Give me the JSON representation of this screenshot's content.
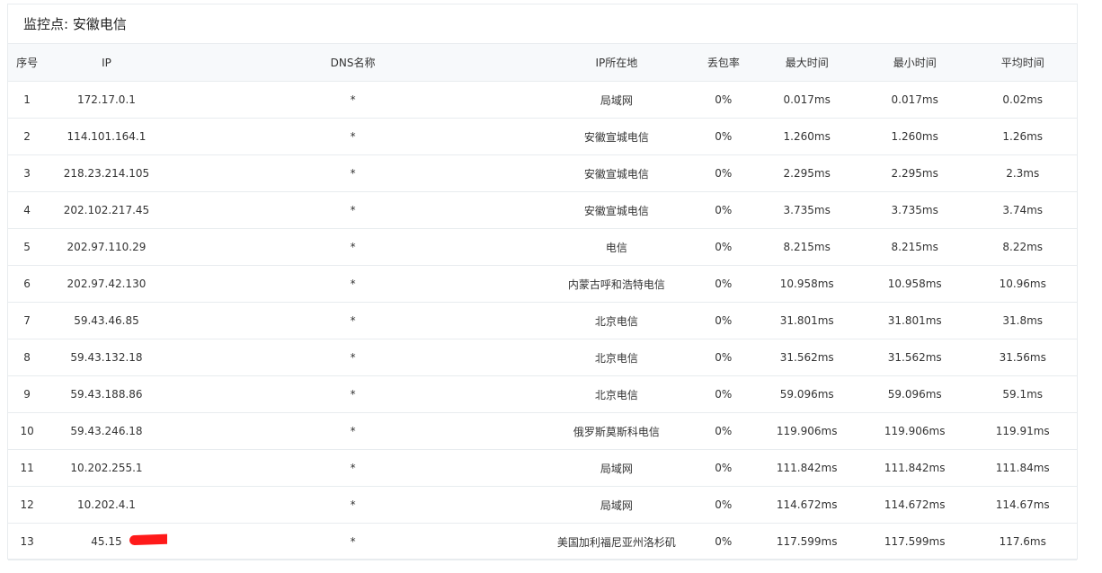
{
  "title": "监控点: 安徽电信",
  "columns": [
    "序号",
    "IP",
    "DNS名称",
    "IP所在地",
    "丢包率",
    "最大时间",
    "最小时间",
    "平均时间"
  ],
  "rows": [
    {
      "no": "1",
      "ip": "172.17.0.1",
      "dns": "*",
      "loc": "局域网",
      "loss": "0%",
      "max": "0.017ms",
      "min": "0.017ms",
      "avg": "0.02ms"
    },
    {
      "no": "2",
      "ip": "114.101.164.1",
      "dns": "*",
      "loc": "安徽宣城电信",
      "loss": "0%",
      "max": "1.260ms",
      "min": "1.260ms",
      "avg": "1.26ms"
    },
    {
      "no": "3",
      "ip": "218.23.214.105",
      "dns": "*",
      "loc": "安徽宣城电信",
      "loss": "0%",
      "max": "2.295ms",
      "min": "2.295ms",
      "avg": "2.3ms"
    },
    {
      "no": "4",
      "ip": "202.102.217.45",
      "dns": "*",
      "loc": "安徽宣城电信",
      "loss": "0%",
      "max": "3.735ms",
      "min": "3.735ms",
      "avg": "3.74ms"
    },
    {
      "no": "5",
      "ip": "202.97.110.29",
      "dns": "*",
      "loc": "电信",
      "loss": "0%",
      "max": "8.215ms",
      "min": "8.215ms",
      "avg": "8.22ms"
    },
    {
      "no": "6",
      "ip": "202.97.42.130",
      "dns": "*",
      "loc": "内蒙古呼和浩特电信",
      "loss": "0%",
      "max": "10.958ms",
      "min": "10.958ms",
      "avg": "10.96ms"
    },
    {
      "no": "7",
      "ip": "59.43.46.85",
      "dns": "*",
      "loc": "北京电信",
      "loss": "0%",
      "max": "31.801ms",
      "min": "31.801ms",
      "avg": "31.8ms"
    },
    {
      "no": "8",
      "ip": "59.43.132.18",
      "dns": "*",
      "loc": "北京电信",
      "loss": "0%",
      "max": "31.562ms",
      "min": "31.562ms",
      "avg": "31.56ms"
    },
    {
      "no": "9",
      "ip": "59.43.188.86",
      "dns": "*",
      "loc": "北京电信",
      "loss": "0%",
      "max": "59.096ms",
      "min": "59.096ms",
      "avg": "59.1ms"
    },
    {
      "no": "10",
      "ip": "59.43.246.18",
      "dns": "*",
      "loc": "俄罗斯莫斯科电信",
      "loss": "0%",
      "max": "119.906ms",
      "min": "119.906ms",
      "avg": "119.91ms"
    },
    {
      "no": "11",
      "ip": "10.202.255.1",
      "dns": "*",
      "loc": "局域网",
      "loss": "0%",
      "max": "111.842ms",
      "min": "111.842ms",
      "avg": "111.84ms"
    },
    {
      "no": "12",
      "ip": "10.202.4.1",
      "dns": "*",
      "loc": "局域网",
      "loss": "0%",
      "max": "114.672ms",
      "min": "114.672ms",
      "avg": "114.67ms"
    },
    {
      "no": "13",
      "ip": "45.15",
      "dns": "*",
      "loc": "美国加利福尼亚州洛杉矶",
      "loss": "0%",
      "max": "117.599ms",
      "min": "117.599ms",
      "avg": "117.6ms",
      "ip_redacted": true
    }
  ],
  "colors": {
    "border": "#e8ecef",
    "header_bg": "#f7f9fb",
    "redaction": "#ff1a1a"
  }
}
